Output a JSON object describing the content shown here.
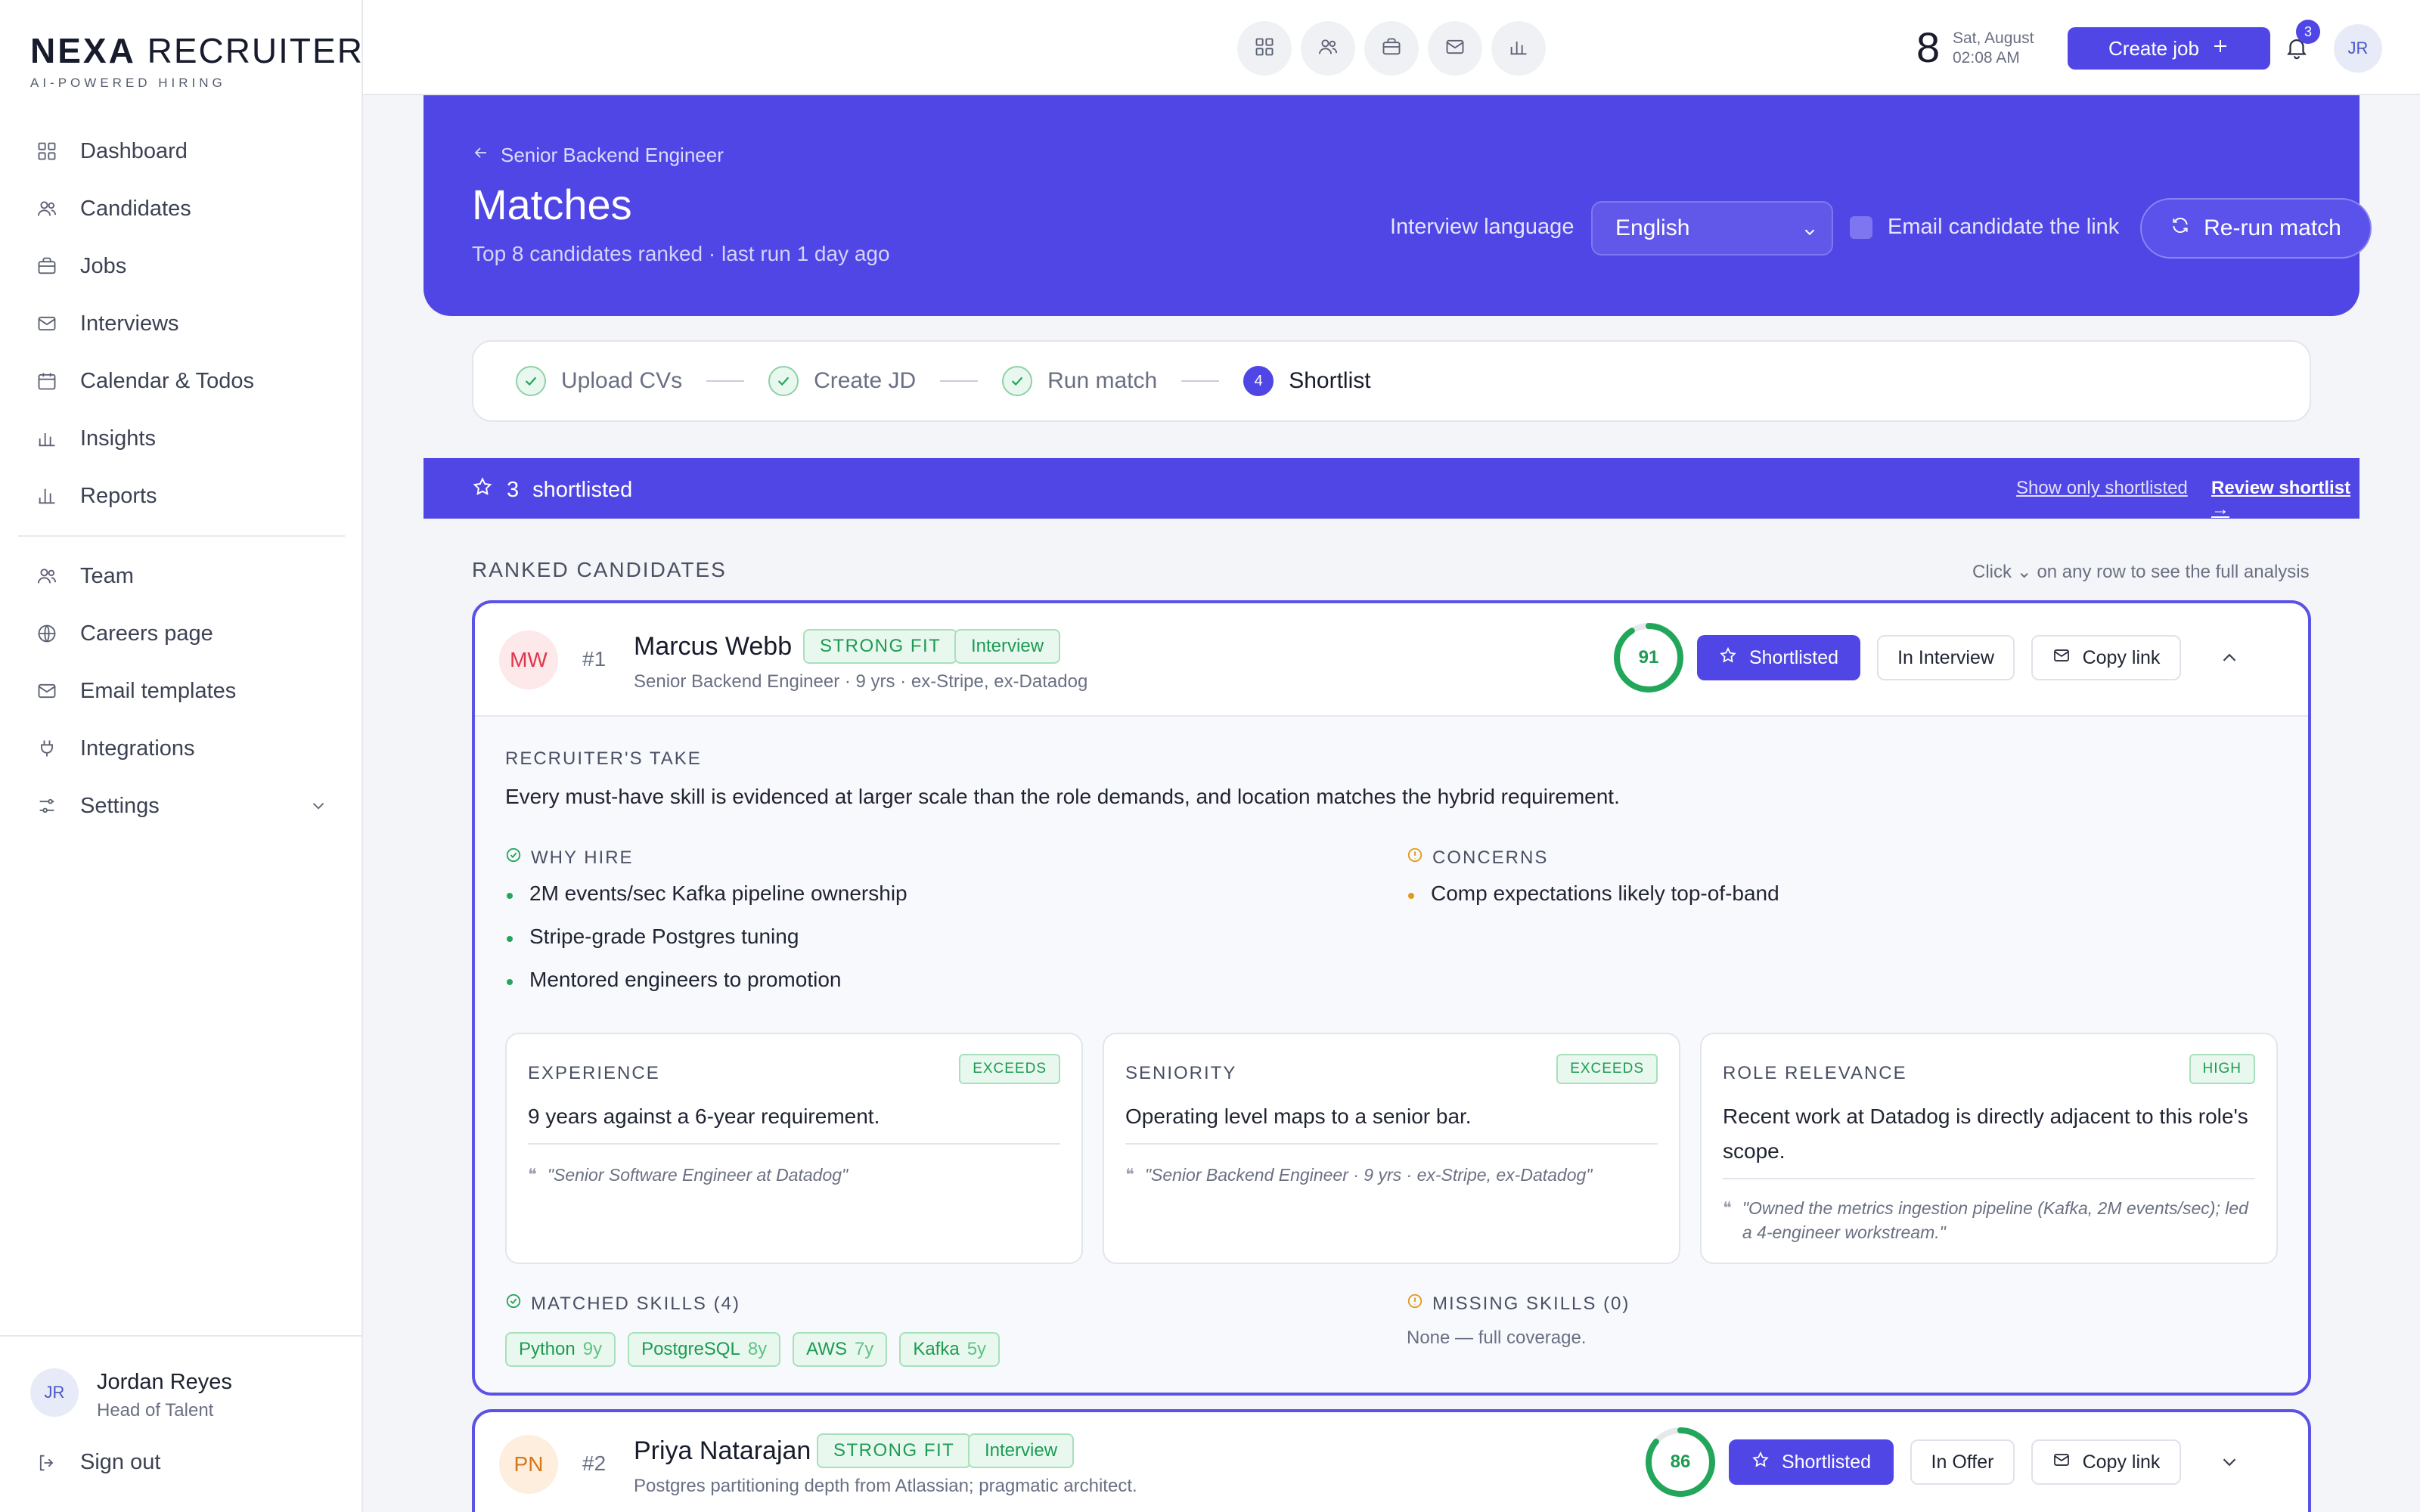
{
  "brand": {
    "name_bold": "NEXA",
    "name_light": "RECRUITER",
    "tagline": "AI-POWERED HIRING"
  },
  "nav": {
    "primary": [
      {
        "label": "Dashboard",
        "icon": "grid-icon"
      },
      {
        "label": "Candidates",
        "icon": "users-icon"
      },
      {
        "label": "Jobs",
        "icon": "briefcase-icon"
      },
      {
        "label": "Interviews",
        "icon": "mail-icon"
      },
      {
        "label": "Calendar & Todos",
        "icon": "calendar-icon"
      },
      {
        "label": "Insights",
        "icon": "bar-chart-icon"
      },
      {
        "label": "Reports",
        "icon": "bar-chart-icon"
      }
    ],
    "secondary": [
      {
        "label": "Team",
        "icon": "users-icon"
      },
      {
        "label": "Careers page",
        "icon": "globe-icon"
      },
      {
        "label": "Email templates",
        "icon": "mail-icon"
      },
      {
        "label": "Integrations",
        "icon": "plug-icon"
      },
      {
        "label": "Settings",
        "icon": "sliders-icon"
      }
    ]
  },
  "user": {
    "initials": "JR",
    "name": "Jordan Reyes",
    "role": "Head of Talent",
    "signout": "Sign out"
  },
  "topbar": {
    "date_day": "8",
    "date_weekday_month": "Sat, August",
    "time": "02:08 AM",
    "create_job": "Create job",
    "notification_count": "3",
    "avatar_initials": "JR"
  },
  "hero": {
    "breadcrumb": "Senior Backend Engineer",
    "title": "Matches",
    "subtitle": "Top 8 candidates ranked · last run 1 day ago",
    "language_label": "Interview language",
    "language_value": "English",
    "email_label": "Email candidate the link",
    "rerun": "Re-run match"
  },
  "steps": [
    {
      "label": "Upload CVs",
      "done": true
    },
    {
      "label": "Create JD",
      "done": true
    },
    {
      "label": "Run match",
      "done": true
    },
    {
      "label": "Shortlist",
      "number": "4",
      "active": true
    }
  ],
  "shortlist_bar": {
    "count": "3",
    "label": "shortlisted",
    "show_only": "Show only shortlisted",
    "review": "Review shortlist →"
  },
  "ranked": {
    "heading": "RANKED CANDIDATES",
    "hint": "Click ⌄ on any row to see the full analysis"
  },
  "candidates": [
    {
      "initials": "MW",
      "rank": "#1",
      "name": "Marcus Webb",
      "fit": "STRONG FIT",
      "stage": "Interview",
      "subtitle": "Senior Backend Engineer · 9 yrs · ex-Stripe, ex-Datadog",
      "score": 91,
      "shortlisted_label": "Shortlisted",
      "status_label": "In Interview",
      "copy_label": "Copy link",
      "recruiter_take_label": "RECRUITER'S TAKE",
      "recruiter_take": "Every must-have skill is evidenced at larger scale than the role demands, and location matches the hybrid requirement.",
      "why_hire_label": "WHY HIRE",
      "why_hire": [
        "2M events/sec Kafka pipeline ownership",
        "Stripe-grade Postgres tuning",
        "Mentored engineers to promotion"
      ],
      "concerns_label": "CONCERNS",
      "concerns": [
        "Comp expectations likely top-of-band"
      ],
      "assessments": [
        {
          "title": "EXPERIENCE",
          "tag": "EXCEEDS",
          "text": "9 years against a 6-year requirement.",
          "quote": "\"Senior Software Engineer at Datadog\""
        },
        {
          "title": "SENIORITY",
          "tag": "EXCEEDS",
          "text": "Operating level maps to a senior bar.",
          "quote": "\"Senior Backend Engineer · 9 yrs · ex-Stripe, ex-Datadog\""
        },
        {
          "title": "ROLE RELEVANCE",
          "tag": "HIGH",
          "text": "Recent work at Datadog is directly adjacent to this role's scope.",
          "quote": "\"Owned the metrics ingestion pipeline (Kafka, 2M events/sec); led a 4-engineer workstream.\""
        }
      ],
      "matched_label": "MATCHED SKILLS (4)",
      "matched_skills": [
        {
          "name": "Python",
          "years": "9y"
        },
        {
          "name": "PostgreSQL",
          "years": "8y"
        },
        {
          "name": "AWS",
          "years": "7y"
        },
        {
          "name": "Kafka",
          "years": "5y"
        }
      ],
      "missing_label": "MISSING SKILLS (0)",
      "missing_text": "None — full coverage."
    },
    {
      "initials": "PN",
      "rank": "#2",
      "name": "Priya Natarajan",
      "fit": "STRONG FIT",
      "stage": "Interview",
      "subtitle": "Postgres partitioning depth from Atlassian; pragmatic architect.",
      "score": 86,
      "shortlisted_label": "Shortlisted",
      "status_label": "In Offer",
      "copy_label": "Copy link"
    }
  ],
  "colors": {
    "accent": "#4f46e5",
    "success": "#22a65a",
    "warning": "#e29a1b"
  }
}
